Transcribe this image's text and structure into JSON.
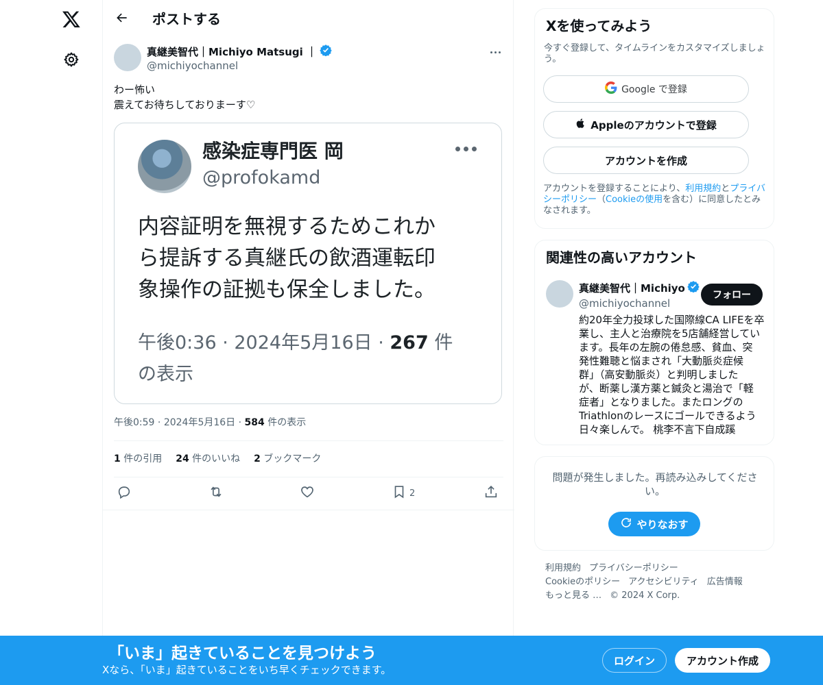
{
  "nav": {
    "logo_icon": "x-logo-icon",
    "settings_icon": "gear-icon"
  },
  "header": {
    "title": "ポストする",
    "back_icon": "arrow-left-icon"
  },
  "post": {
    "author_name": "真継美智代｜Michiyo Matsugi ｜",
    "author_handle": "@michiyochannel",
    "text_lines": [
      "わー怖い",
      "震えてお待ちしておりまーす♡"
    ],
    "meta_time": "午後0:59",
    "meta_date": "2024年5月16日",
    "meta_views_count": "584",
    "meta_views_label": "件の表示",
    "stats": {
      "quotes_count": "1",
      "quotes_label": "件の引用",
      "likes_count": "24",
      "likes_label": "件のいいね",
      "bookmarks_count": "2",
      "bookmarks_label": "ブックマーク"
    },
    "bookmark_action_count": "2"
  },
  "embedded_image": {
    "name": "感染症専門医 岡",
    "handle": "@profokamd",
    "body_lines": [
      "内容証明を無視するためこれか",
      "ら提訴する真継氏の飲酒運転印",
      "象操作の証拠も保全しました。"
    ],
    "meta_prefix": "午後0:36 · 2024年5月16日 · ",
    "meta_views": "267",
    "meta_suffix": " 件",
    "meta_line2": "の表示"
  },
  "signup": {
    "title": "Xを使ってみよう",
    "subtitle": "今すぐ登録して、タイムラインをカスタマイズしましょう。",
    "google_label": "Google で登録",
    "apple_label": "Appleのアカウントで登録",
    "create_label": "アカウントを作成",
    "terms_prefix": "アカウントを登録することにより、",
    "terms_link1": "利用規約",
    "terms_and": "と",
    "terms_link2": "プライバシーポリシー",
    "terms_mid": "（",
    "terms_link3": "Cookieの使用",
    "terms_suffix": "を含む）に同意したとみなされます。"
  },
  "relevant": {
    "title": "関連性の高いアカウント",
    "name": "真継美智代｜Michiyo",
    "handle": "@michiyochannel",
    "follow_label": "フォロー",
    "bio_lines": [
      "約20年全力投球した国際線CA LIFEを卒",
      "業し、主人と治療院を5店舗経営してい",
      "ます。長年の左腕の倦怠感、貧血、突",
      "発性難聴と悩まされ「大動脈炎症候",
      "群」（高安動脈炎）と判明しました",
      "が、断薬し漢方薬と鍼灸と湯治で「軽",
      "症者」となりました。またロングの",
      "Triathlonのレースにゴールできるよう",
      "日々楽しんで。 桃李不言下自成蹊"
    ]
  },
  "error_box": {
    "message": "問題が発生しました。再読み込みしてください。",
    "retry_label": "やりなおす"
  },
  "footer": {
    "links": [
      "利用規約",
      "プライバシーポリシー",
      "Cookieのポリシー",
      "アクセシビリティ",
      "広告情報",
      "もっと見る …"
    ],
    "copyright": "© 2024 X Corp."
  },
  "banner": {
    "title": "「いま」起きていることを見つけよう",
    "subtitle": "Xなら、「いま」起きていることをいち早くチェックできます。",
    "login_label": "ログイン",
    "signup_label": "アカウント作成"
  },
  "colors": {
    "accent": "#1d9bf0",
    "text": "#0f1419",
    "muted": "#536471",
    "verified": "#1d9bf0"
  }
}
